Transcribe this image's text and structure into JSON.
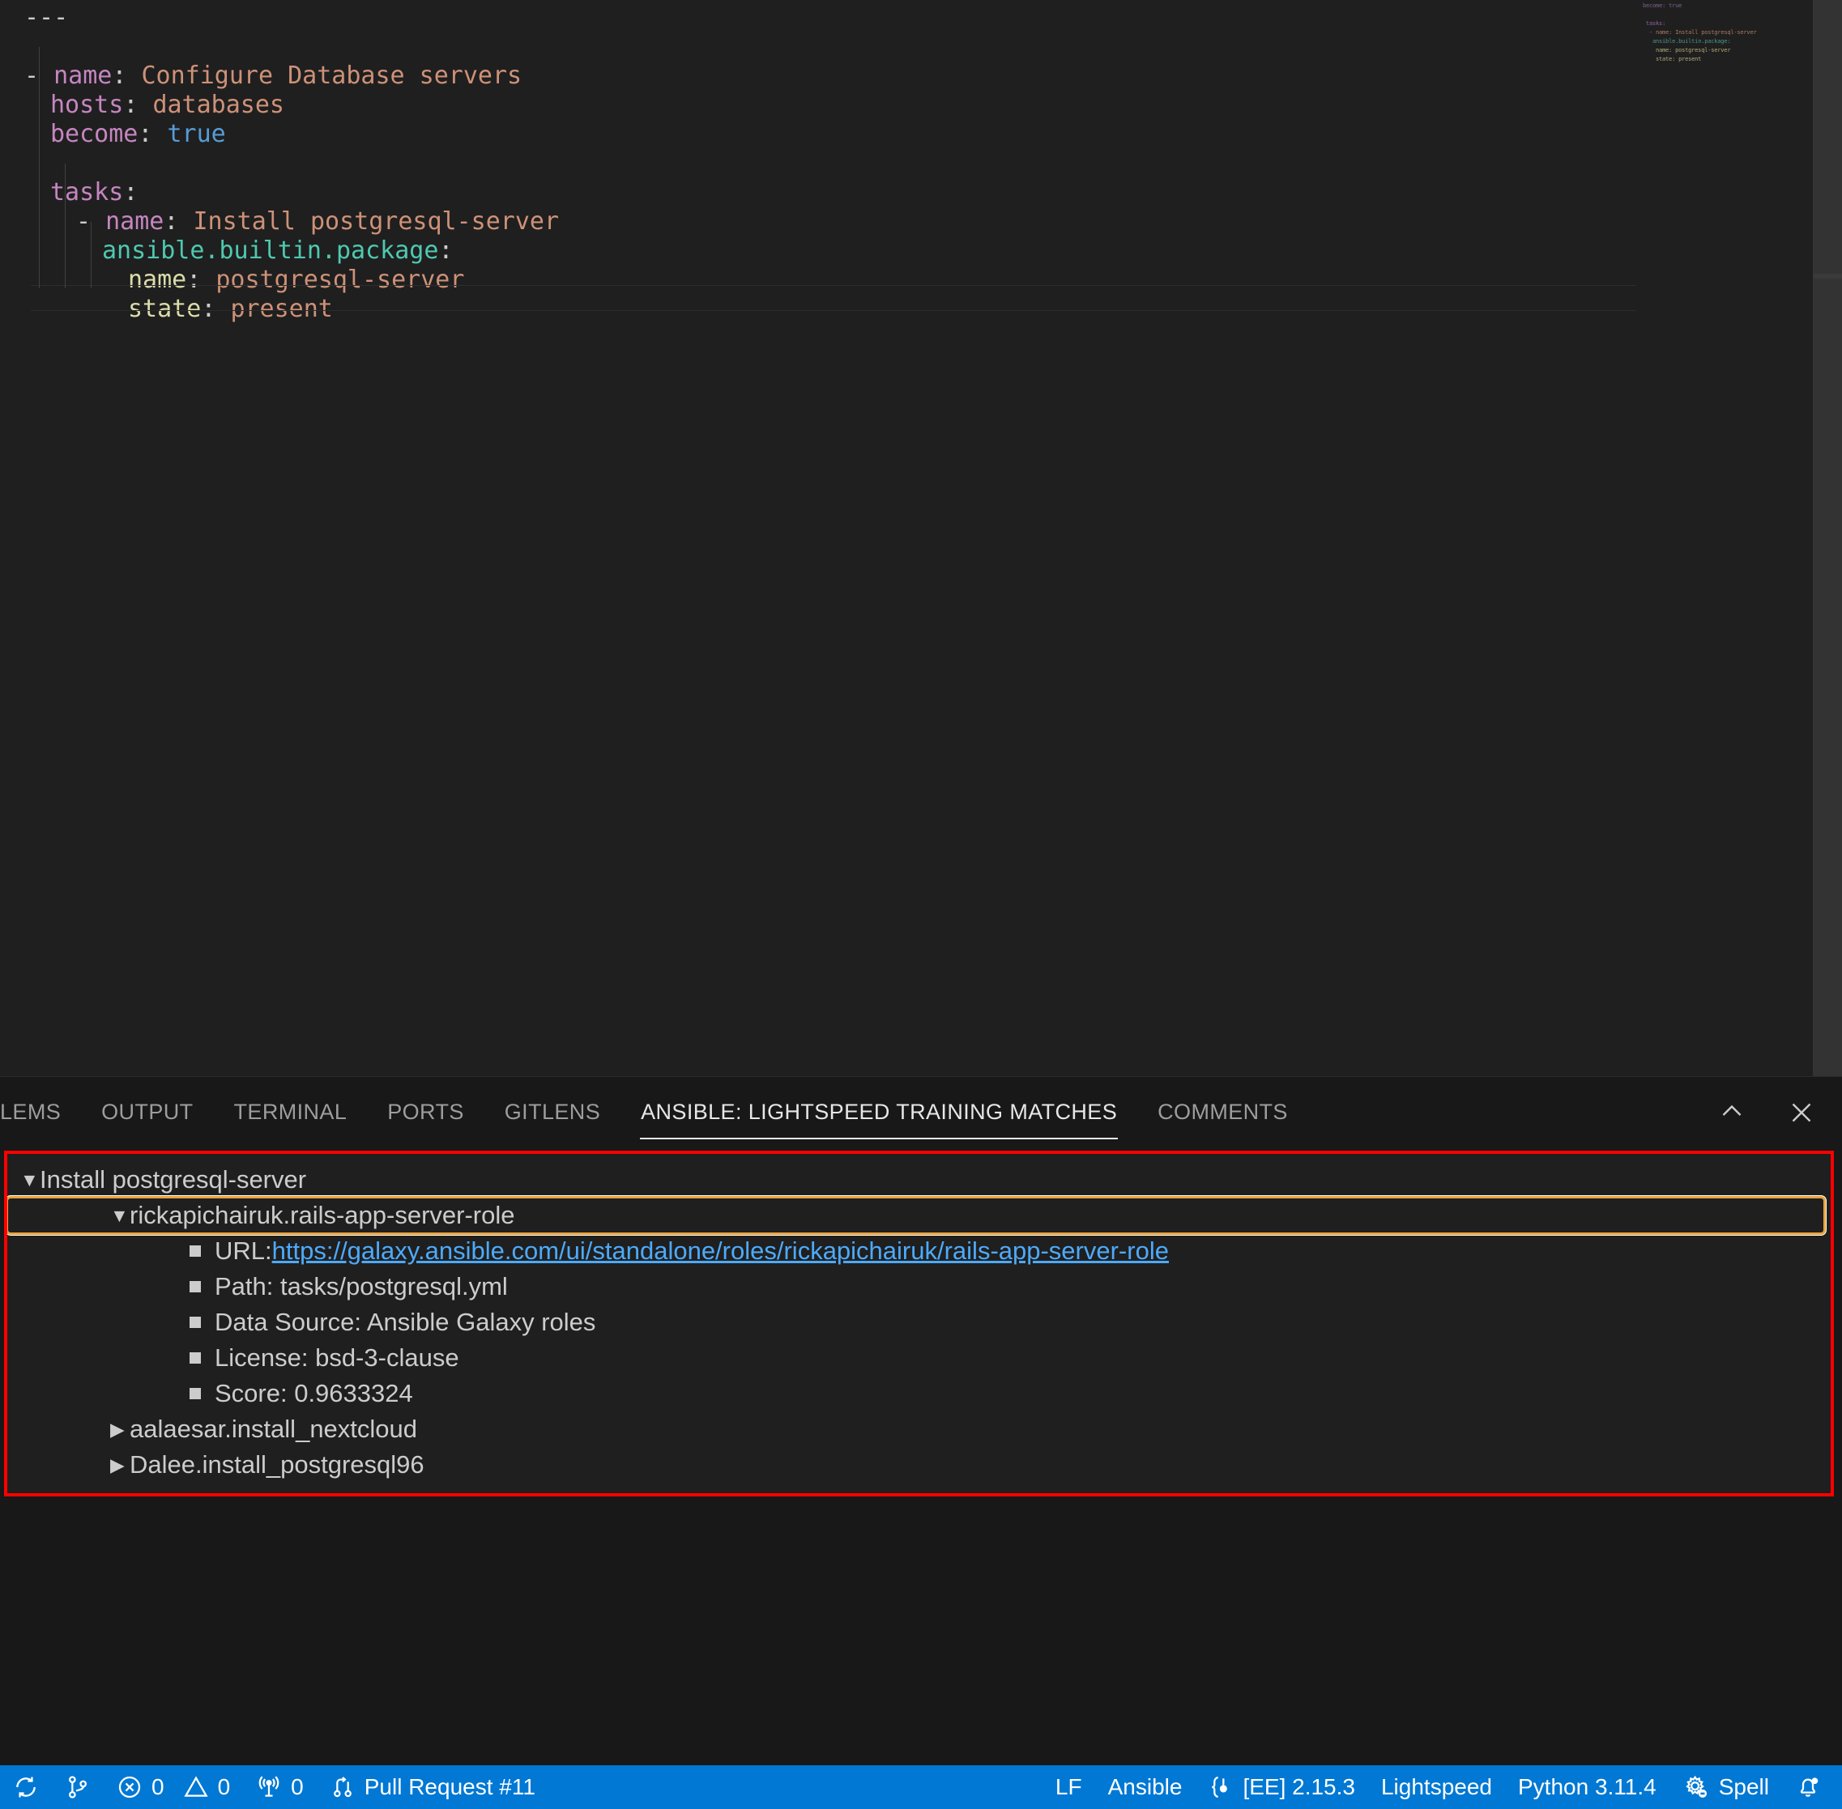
{
  "editor": {
    "language": "yaml",
    "lines": [
      {
        "indent": 0,
        "tokens": [
          {
            "t": "---",
            "c": "punct"
          }
        ]
      },
      {
        "indent": 0,
        "tokens": []
      },
      {
        "indent": 0,
        "tokens": [
          {
            "t": "- ",
            "c": "dash"
          },
          {
            "t": "name",
            "c": "key"
          },
          {
            "t": ": ",
            "c": "punct"
          },
          {
            "t": "Configure Database servers",
            "c": "str"
          }
        ]
      },
      {
        "indent": 1,
        "tokens": [
          {
            "t": "hosts",
            "c": "key"
          },
          {
            "t": ": ",
            "c": "punct"
          },
          {
            "t": "databases",
            "c": "str"
          }
        ]
      },
      {
        "indent": 1,
        "tokens": [
          {
            "t": "become",
            "c": "key"
          },
          {
            "t": ": ",
            "c": "punct"
          },
          {
            "t": "true",
            "c": "bool"
          }
        ]
      },
      {
        "indent": 0,
        "tokens": []
      },
      {
        "indent": 1,
        "tokens": [
          {
            "t": "tasks",
            "c": "key"
          },
          {
            "t": ":",
            "c": "punct"
          }
        ]
      },
      {
        "indent": 2,
        "tokens": [
          {
            "t": "- ",
            "c": "dash"
          },
          {
            "t": "name",
            "c": "key"
          },
          {
            "t": ": ",
            "c": "punct"
          },
          {
            "t": "Install postgresql-server",
            "c": "str"
          }
        ]
      },
      {
        "indent": 3,
        "tokens": [
          {
            "t": "ansible.builtin.package",
            "c": "mod"
          },
          {
            "t": ":",
            "c": "punct"
          }
        ]
      },
      {
        "indent": 4,
        "tokens": [
          {
            "t": "name",
            "c": "key2"
          },
          {
            "t": ": ",
            "c": "punct"
          },
          {
            "t": "postgresql-server",
            "c": "str"
          }
        ]
      },
      {
        "indent": 4,
        "tokens": [
          {
            "t": "state",
            "c": "key2"
          },
          {
            "t": ": ",
            "c": "punct"
          },
          {
            "t": "present",
            "c": "str"
          }
        ]
      }
    ],
    "minimap_lines": [
      "become: true",
      "",
      "  tasks:",
      "    - name: Install postgresql-server",
      "      ansible.builtin.package:",
      "        name: postgresql-server",
      "        state: present"
    ]
  },
  "panel": {
    "tabs": [
      {
        "label": "LEMS",
        "active": false
      },
      {
        "label": "OUTPUT",
        "active": false
      },
      {
        "label": "TERMINAL",
        "active": false
      },
      {
        "label": "PORTS",
        "active": false
      },
      {
        "label": "GITLENS",
        "active": false
      },
      {
        "label": "ANSIBLE: LIGHTSPEED TRAINING MATCHES",
        "active": true
      },
      {
        "label": "COMMENTS",
        "active": false
      }
    ],
    "actions": [
      {
        "name": "chevron-up-icon",
        "title": "Maximize Panel Size"
      },
      {
        "name": "close-icon",
        "title": "Close Panel"
      }
    ],
    "tree": [
      {
        "depth": 0,
        "twisty": "▼",
        "text": "Install postgresql-server",
        "kind": "node",
        "focused": false
      },
      {
        "depth": 1,
        "twisty": "▼",
        "text": "rickapichairuk.rails-app-server-role",
        "kind": "node",
        "focused": true
      },
      {
        "depth": 2,
        "twisty": "",
        "label": "URL: ",
        "link": "https://galaxy.ansible.com/ui/standalone/roles/rickapichairuk/rails-app-server-role",
        "kind": "leaf-link",
        "focused": false
      },
      {
        "depth": 2,
        "twisty": "",
        "text": "Path: tasks/postgresql.yml",
        "kind": "leaf",
        "focused": false
      },
      {
        "depth": 2,
        "twisty": "",
        "text": "Data Source: Ansible Galaxy roles",
        "kind": "leaf",
        "focused": false
      },
      {
        "depth": 2,
        "twisty": "",
        "text": "License: bsd-3-clause",
        "kind": "leaf",
        "focused": false
      },
      {
        "depth": 2,
        "twisty": "",
        "text": "Score: 0.9633324",
        "kind": "leaf",
        "focused": false
      },
      {
        "depth": 1,
        "twisty": "▶",
        "text": "aalaesar.install_nextcloud",
        "kind": "node",
        "focused": false
      },
      {
        "depth": 1,
        "twisty": "▶",
        "text": "Dalee.install_postgresql96",
        "kind": "node",
        "focused": false
      }
    ]
  },
  "statusbar": {
    "background": "#0078d4",
    "foreground": "#ffffff",
    "left": [
      {
        "icon": "remote-sync-icon",
        "label": ""
      },
      {
        "icon": "source-control-icon",
        "label": ""
      },
      {
        "icon": "error-icon",
        "label": "0",
        "icon2": "warning-icon",
        "label2": "0"
      },
      {
        "icon": "radio-tower-icon",
        "label": "0"
      },
      {
        "icon": "git-pull-request-icon",
        "label": "Pull Request #11"
      }
    ],
    "right": [
      {
        "icon": "",
        "label": "LF"
      },
      {
        "icon": "",
        "label": "Ansible"
      },
      {
        "icon": "ansible-ee-icon",
        "label": "[EE] 2.15.3"
      },
      {
        "icon": "",
        "label": "Lightspeed"
      },
      {
        "icon": "",
        "label": "Python 3.11.4"
      },
      {
        "icon": "spell-check-icon",
        "label": "Spell"
      },
      {
        "icon": "bell-dot-icon",
        "label": ""
      }
    ]
  }
}
